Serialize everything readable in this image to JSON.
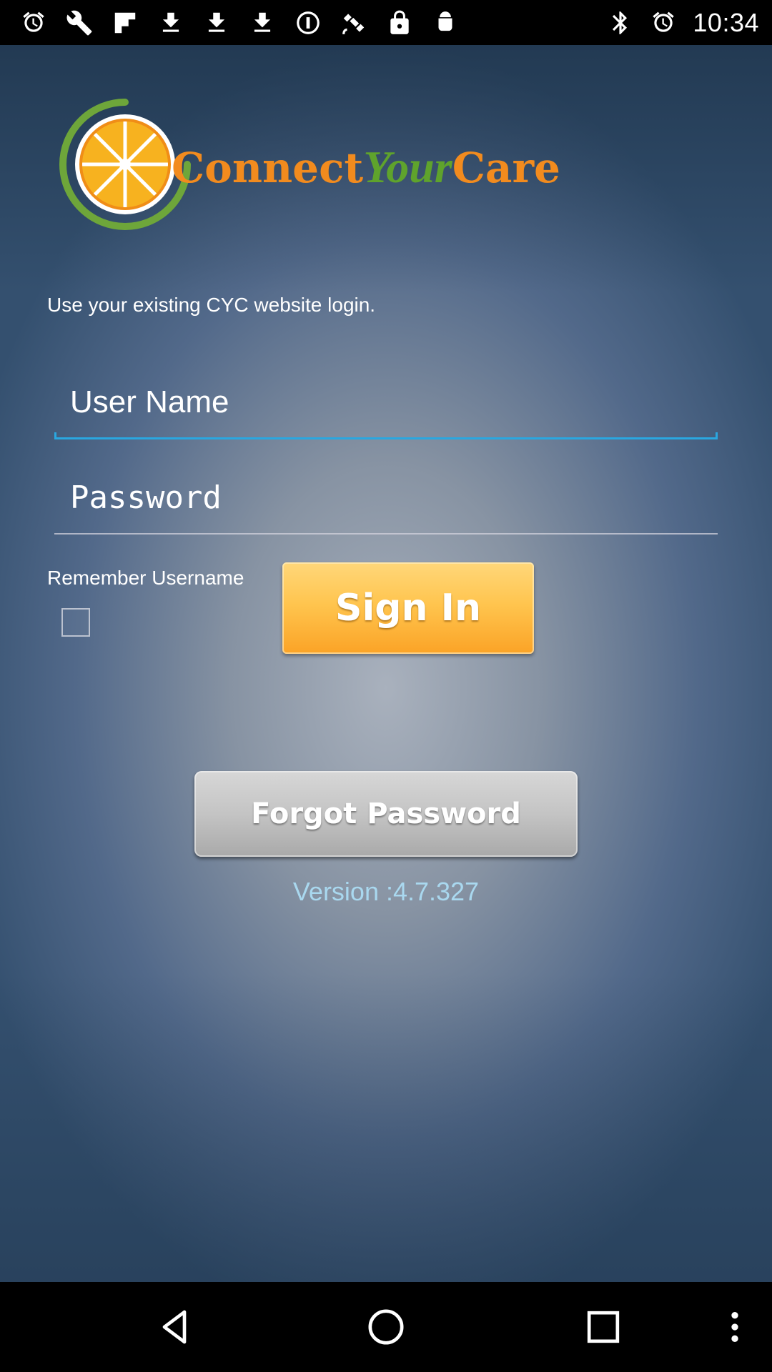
{
  "status_bar": {
    "time": "10:34",
    "left_icons": [
      "alarm-icon",
      "wrench-icon",
      "flipboard-icon",
      "download-icon",
      "download-icon",
      "download-icon",
      "pause-circle-icon",
      "satellite-icon",
      "lock-icon",
      "android-icon"
    ],
    "right_icons": [
      "bluetooth-icon",
      "alarm-icon"
    ]
  },
  "logo": {
    "word1": "Connect",
    "word2": "Your",
    "word3": "Care",
    "colors": {
      "orange": "#f28b1e",
      "green": "#5fa32c"
    }
  },
  "login": {
    "instructions": "Use your existing CYC website login.",
    "username_placeholder": "User Name",
    "password_placeholder": "Password",
    "remember_label": "Remember Username",
    "remember_checked": false,
    "signin_label": "Sign In",
    "forgot_label": "Forgot Password",
    "version": "Version :4.7.327"
  },
  "nav_bar": {
    "back": "back-icon",
    "home": "home-icon",
    "recents": "recents-icon",
    "menu": "more-vert-icon"
  }
}
